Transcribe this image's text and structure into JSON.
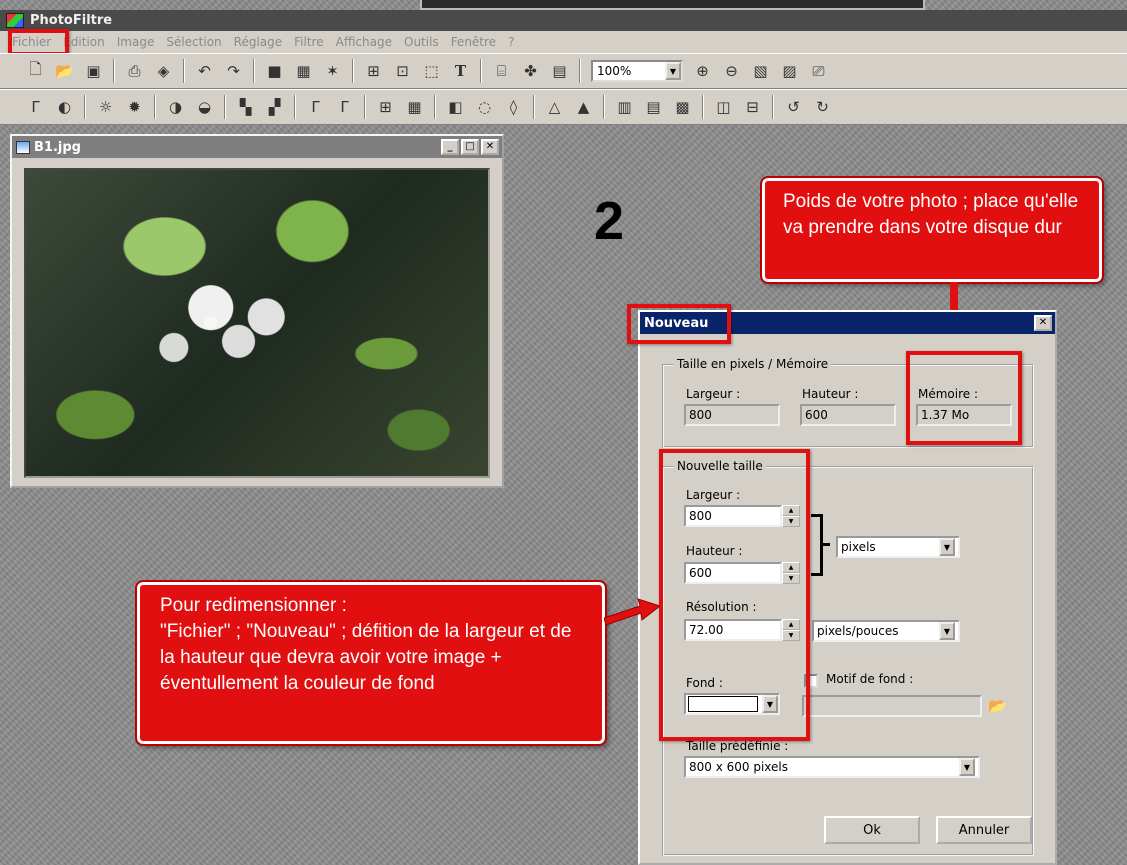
{
  "app": {
    "title": "PhotoFiltre"
  },
  "menu": {
    "items": [
      "Fichier",
      "Edition",
      "Image",
      "Sélection",
      "Réglage",
      "Filtre",
      "Affichage",
      "Outils",
      "Fenêtre",
      "?"
    ]
  },
  "toolbar1": {
    "zoom_value": "100%"
  },
  "image_window": {
    "title": "B1.jpg"
  },
  "step": {
    "number": "2"
  },
  "callouts": {
    "weight": "Poids de votre photo ; place qu'elle va prendre dans votre disque dur",
    "resize": {
      "line1": "Pour redimensionner :",
      "line2": "\"Fichier\" ; \"Nouveau\" ; défition de la largeur et de la hauteur que devra avoir votre image + éventullement la couleur de fond"
    }
  },
  "dialog": {
    "title": "Nouveau",
    "memory_group": {
      "legend": "Taille en pixels / Mémoire",
      "width_label": "Largeur :",
      "width_value": "800",
      "height_label": "Hauteur :",
      "height_value": "600",
      "memory_label": "Mémoire :",
      "memory_value": "1.37 Mo"
    },
    "new_size": {
      "legend": "Nouvelle taille",
      "width_label": "Largeur :",
      "width_value": "800",
      "height_label": "Hauteur :",
      "height_value": "600",
      "unit_value": "pixels",
      "resolution_label": "Résolution :",
      "resolution_value": "72.00",
      "resolution_unit": "pixels/pouces",
      "background_label": "Fond :",
      "pattern_label": "Motif de fond :",
      "preset_label": "Taille prédéfinie :",
      "preset_value": "800 x 600 pixels"
    },
    "ok_label": "Ok",
    "cancel_label": "Annuler"
  },
  "colors": {
    "accent_red": "#e10f0f",
    "dialog_title": "#0a246a"
  }
}
